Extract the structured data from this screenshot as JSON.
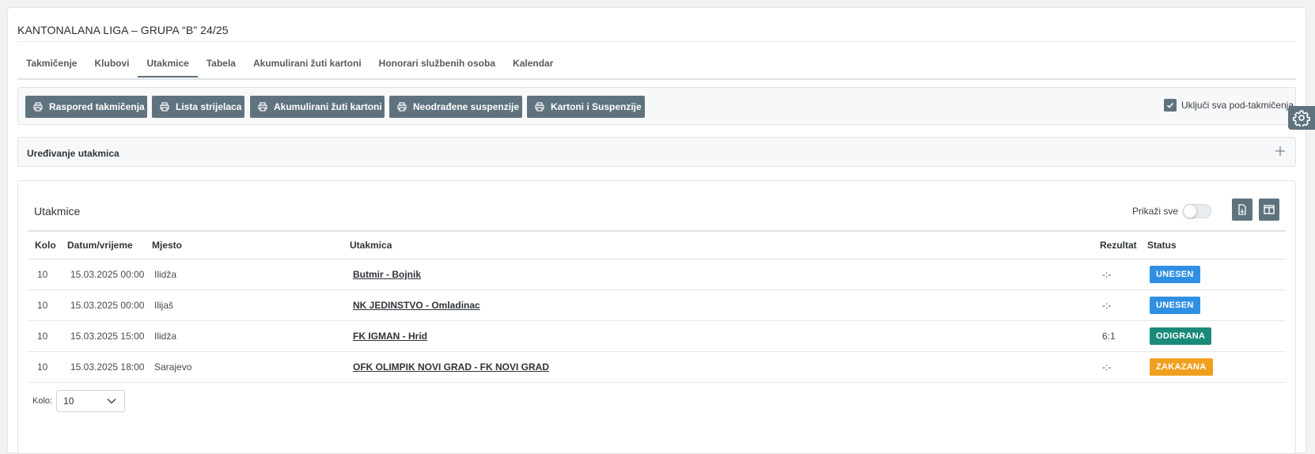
{
  "page": {
    "title": "KANTONALANA LIGA – GRUPA “B” 24/25"
  },
  "tabs": [
    {
      "label": "Takmičenje"
    },
    {
      "label": "Klubovi"
    },
    {
      "label": "Utakmice",
      "active": true
    },
    {
      "label": "Tabela"
    },
    {
      "label": "Akumulirani žuti kartoni"
    },
    {
      "label": "Honorari službenih osoba"
    },
    {
      "label": "Kalendar"
    }
  ],
  "toolbar": {
    "buttons": [
      {
        "label": "Raspored takmičenja",
        "icon": "printer-icon"
      },
      {
        "label": "Lista strijelaca",
        "icon": "printer-icon"
      },
      {
        "label": "Akumulirani žuti kartoni",
        "icon": "printer-icon"
      },
      {
        "label": "Neodrađene suspenzije",
        "icon": "printer-icon"
      },
      {
        "label": "Kartoni i Suspenzije",
        "icon": "printer-icon"
      }
    ],
    "include_sub": {
      "label": "Uključi sva pod-takmičenja",
      "checked": true
    }
  },
  "accordion": {
    "title": "Uređivanje utakmica",
    "icon": "plus-icon"
  },
  "matches": {
    "title": "Utakmice",
    "show_all": {
      "label": "Prikaži sve",
      "on": false
    },
    "columns": {
      "kolo": "Kolo",
      "datum": "Datum/vrijeme",
      "mjesto": "Mjesto",
      "utakmica": "Utakmica",
      "rezultat": "Rezultat",
      "status": "Status"
    },
    "rows": [
      {
        "kolo": "10",
        "datum": "15.03.2025 00:00",
        "mjesto": "Ilidža",
        "utakmica": "Butmir - Bojnik",
        "rezultat": "-:-",
        "status": "UNESEN"
      },
      {
        "kolo": "10",
        "datum": "15.03.2025 00:00",
        "mjesto": "Ilijaš",
        "utakmica": "NK JEDINSTVO - Omladinac",
        "rezultat": "-:-",
        "status": "UNESEN"
      },
      {
        "kolo": "10",
        "datum": "15.03.2025 15:00",
        "mjesto": "Ilidža",
        "utakmica": "FK IGMAN - Hrid",
        "rezultat": "6:1",
        "status": "ODIGRANA"
      },
      {
        "kolo": "10",
        "datum": "15.03.2025 18:00",
        "mjesto": "Sarajevo",
        "utakmica": "OFK OLIMPIK NOVI GRAD - FK NOVI GRAD",
        "rezultat": "-:-",
        "status": "ZAKAZANA"
      }
    ],
    "kolo_filter": {
      "label": "Kolo:",
      "value": "10"
    }
  },
  "colors": {
    "primary": "#5f737e",
    "status_unesen": "#2f8fe3",
    "status_odigrana": "#1a8a79",
    "status_zakazana": "#f0a01f"
  }
}
